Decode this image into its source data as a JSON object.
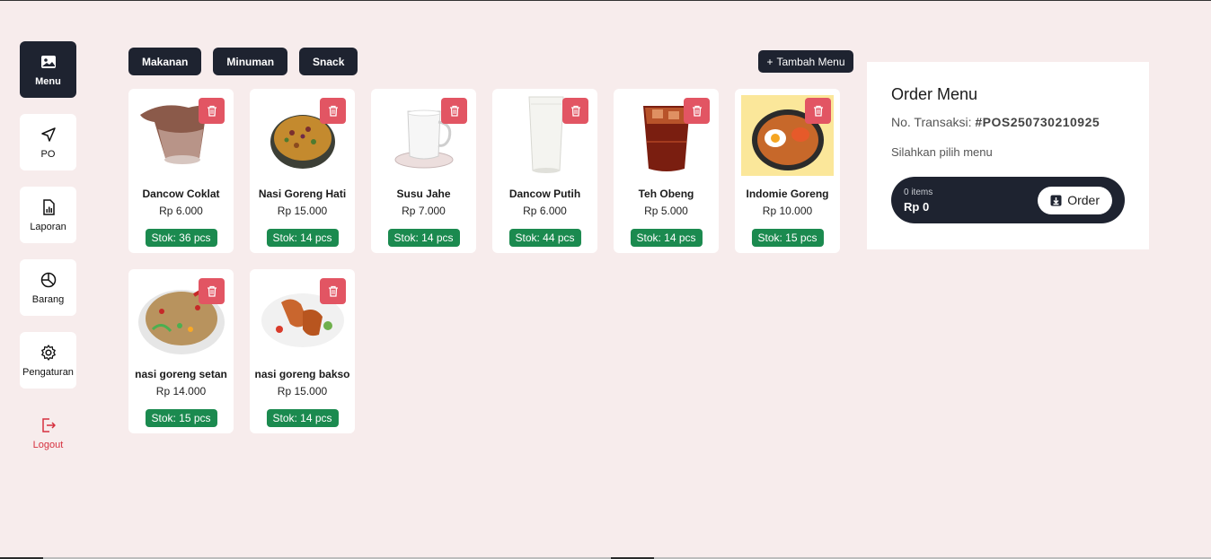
{
  "sidebar": {
    "items": [
      {
        "label": "Menu",
        "icon": "image-icon"
      },
      {
        "label": "PO",
        "icon": "send-icon"
      },
      {
        "label": "Laporan",
        "icon": "report-icon"
      },
      {
        "label": "Barang",
        "icon": "pie-chart-icon"
      },
      {
        "label": "Pengaturan",
        "icon": "gear-icon"
      },
      {
        "label": "Logout",
        "icon": "logout-icon"
      }
    ]
  },
  "categories": [
    "Makanan",
    "Minuman",
    "Snack"
  ],
  "add_menu": {
    "icon": "+",
    "label": "Tambah Menu"
  },
  "products": [
    {
      "name": "Dancow Coklat",
      "price": "Rp 6.000",
      "stock": "Stok: 36 pcs"
    },
    {
      "name": "Nasi Goreng Hati",
      "price": "Rp 15.000",
      "stock": "Stok: 14 pcs"
    },
    {
      "name": "Susu Jahe",
      "price": "Rp 7.000",
      "stock": "Stok: 14 pcs"
    },
    {
      "name": "Dancow Putih",
      "price": "Rp 6.000",
      "stock": "Stok: 44 pcs"
    },
    {
      "name": "Teh Obeng",
      "price": "Rp 5.000",
      "stock": "Stok: 14 pcs"
    },
    {
      "name": "Indomie Goreng",
      "price": "Rp 10.000",
      "stock": "Stok: 15 pcs"
    },
    {
      "name": "nasi goreng setan",
      "price": "Rp 14.000",
      "stock": "Stok: 15 pcs"
    },
    {
      "name": "nasi goreng bakso",
      "price": "Rp 15.000",
      "stock": "Stok: 14 pcs"
    }
  ],
  "order": {
    "title": "Order Menu",
    "transaction_label": "No. Transaksi:",
    "transaction_id": "#POS250730210925",
    "hint": "Silahkan pilih menu",
    "items_count": "0 items",
    "total": "Rp 0",
    "button_label": "Order"
  },
  "colors": {
    "accent": "#1e2330",
    "danger": "#e25563",
    "success": "#1b8a4f",
    "logout": "#d6303e",
    "background": "#f7ecec"
  }
}
